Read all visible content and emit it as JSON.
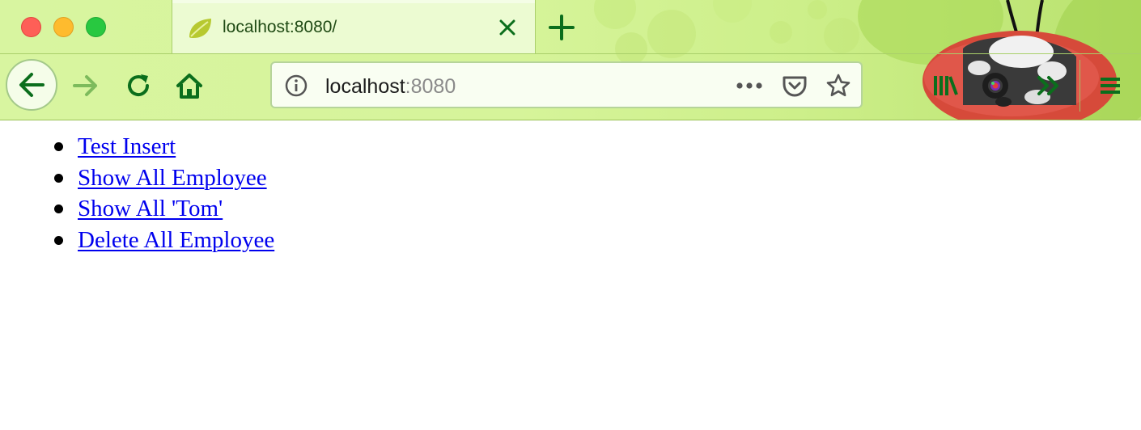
{
  "browser": {
    "tab": {
      "title": "localhost:8080/",
      "favicon": "spring-leaf-icon"
    },
    "new_tab": "plus-icon",
    "address_bar": {
      "host": "localhost",
      "port": ":8080"
    },
    "toolbar_icons": {
      "back": "back-arrow-icon",
      "forward": "forward-arrow-icon",
      "reload": "reload-icon",
      "home": "home-icon",
      "page_info": "info-icon",
      "page_actions": "more-icon",
      "pocket": "pocket-icon",
      "bookmark": "star-icon",
      "library": "library-icon",
      "extension": "camera-lens-icon",
      "overflow": "double-chevron-icon",
      "menu": "hamburger-menu-icon"
    },
    "theme_colors": {
      "accent": "#0a7a1e",
      "chrome": "#d8f5a0"
    }
  },
  "page": {
    "links": [
      {
        "label": "Test Insert"
      },
      {
        "label": "Show All Employee"
      },
      {
        "label": "Show All 'Tom'"
      },
      {
        "label": "Delete All Employee"
      }
    ],
    "link_color": "#0000ee"
  }
}
